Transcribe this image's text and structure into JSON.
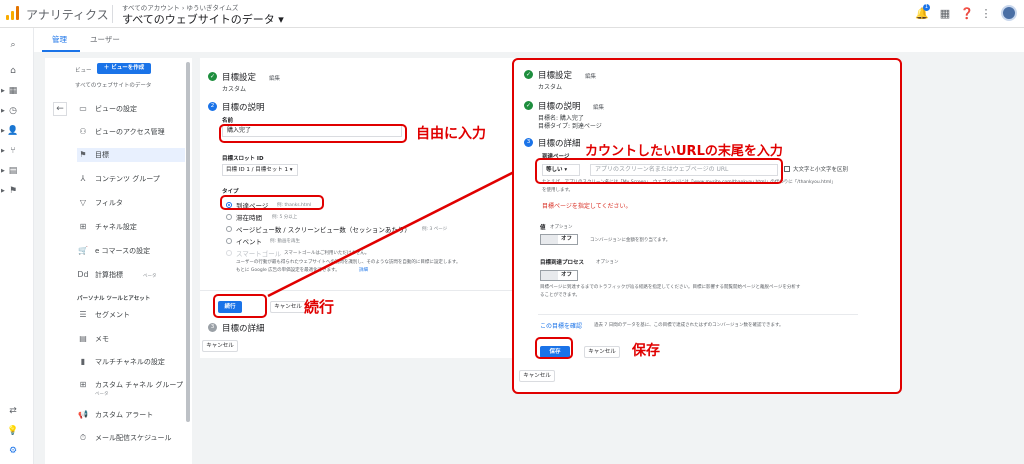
{
  "header": {
    "app_title": "アナリティクス",
    "breadcrumb": "すべてのアカウント › ゆういぎタイムズ",
    "property": "すべてのウェブサイトのデータ",
    "notification_count": "1"
  },
  "tabs": {
    "admin": "管理",
    "user": "ユーザー"
  },
  "view_panel": {
    "view_label": "ビュー",
    "new_view_button": "＋ ビューを作成",
    "view_name": "すべてのウェブサイトのデータ",
    "items": [
      {
        "icon": "▭",
        "label": "ビューの設定"
      },
      {
        "icon": "⚇",
        "label": "ビューのアクセス管理"
      },
      {
        "icon": "⚑",
        "label": "目標"
      },
      {
        "icon": "⅄",
        "label": "コンテンツ グループ"
      },
      {
        "icon": "▽",
        "label": "フィルタ"
      },
      {
        "icon": "⊞",
        "label": "チャネル設定"
      },
      {
        "icon": "🛒",
        "label": "e コマースの設定"
      },
      {
        "icon": "Dd",
        "label": "計算指標",
        "sub": "ベータ"
      }
    ],
    "section_label": "パーソナル ツールとアセット",
    "personal_items": [
      {
        "icon": "☰",
        "label": "セグメント"
      },
      {
        "icon": "▤",
        "label": "メモ"
      },
      {
        "icon": "▮",
        "label": "マルチチャネルの設定"
      },
      {
        "icon": "⊞",
        "label": "カスタム チャネル グループ",
        "sub": "ベータ"
      },
      {
        "icon": "📢",
        "label": "カスタム アラート"
      },
      {
        "icon": "⏱",
        "label": "メール配信スケジュール"
      }
    ]
  },
  "goal_card": {
    "step1_title": "目標設定",
    "step1_edit": "編集",
    "step1_value": "カスタム",
    "step2_title": "目標の説明",
    "name_label": "名前",
    "name_value": "購入完了",
    "slot_label": "目標スロット ID",
    "slot_value": "目標 ID 1 / 目標セット 1 ▾",
    "type_label": "タイプ",
    "types": [
      {
        "label": "到達ページ",
        "example": "例: thanks.html"
      },
      {
        "label": "滞在時間",
        "example": "例: 5 分以上"
      },
      {
        "label": "ページビュー数 / スクリーンビュー数（セッションあたり）",
        "example": "例: 3 ページ"
      },
      {
        "label": "イベント",
        "example": "例: 動画を再生"
      },
      {
        "label": "スマートゴール",
        "example": "スマートゴールはご利用いただけません。"
      }
    ],
    "smart_help_1": "ユーザーの行動が最も得られたウェブサイトへの訪問を識別し、そのような訪問を自動的に目標に設定します。",
    "smart_help_2": "もとに Google 広告の単価設定を最適化できます。",
    "smart_help_link": "詳細",
    "continue_button": "続行",
    "cancel_button": "キャンセル",
    "step3_title": "目標の詳細",
    "bottom_cancel": "キャンセル"
  },
  "detail_card": {
    "step1_title": "目標設定",
    "step1_edit": "編集",
    "step1_value": "カスタム",
    "step2_title": "目標の説明",
    "step2_edit": "編集",
    "step2_name": "目標名: 購入完了",
    "step2_type": "目標タイプ: 到達ページ",
    "step3_title": "目標の詳細",
    "dest_label": "到達ページ",
    "match_select": "等しい ▾",
    "dest_placeholder": "アプリのスクリーン名またはウェブページの URL",
    "case_sensitive": "大文字と小文字を区別",
    "dest_help_1": "たとえば、アプリのスクリーン名には「My Screen」、ウェブページには「www.mysite.com/thankyou.html」の代わりに「/thankyou.html」",
    "dest_help_2": "を使用します。",
    "error": "目標ページを指定してください。",
    "value_label": "値",
    "value_optional": "オプション",
    "value_toggle": "オフ",
    "value_help": "コンバージョンに金額を割り当てます。",
    "funnel_label": "目標到達プロセス",
    "funnel_optional": "オプション",
    "funnel_toggle": "オフ",
    "funnel_help_1": "目標ページに到達するまでのトラフィックが辿る経路を指定してください。目標に影響する閲覧開始ページと離脱ページを分析す",
    "funnel_help_2": "ることができます。",
    "verify_link": "この目標を確認",
    "verify_help": "過去 7 日間のデータを基に、この目標で達成されたはずのコンバージョン数を確認できます。",
    "save_button": "保存",
    "cancel_button": "キャンセル",
    "bottom_cancel": "キャンセル"
  },
  "annotations": {
    "free_input": "自由に入力",
    "continue": "続行",
    "url_suffix": "カウントしたいURLの末尾を入力",
    "save": "保存"
  },
  "colors": {
    "accent": "#1a73e8",
    "annotation_red": "#e00000",
    "success": "#1e8e3e"
  }
}
